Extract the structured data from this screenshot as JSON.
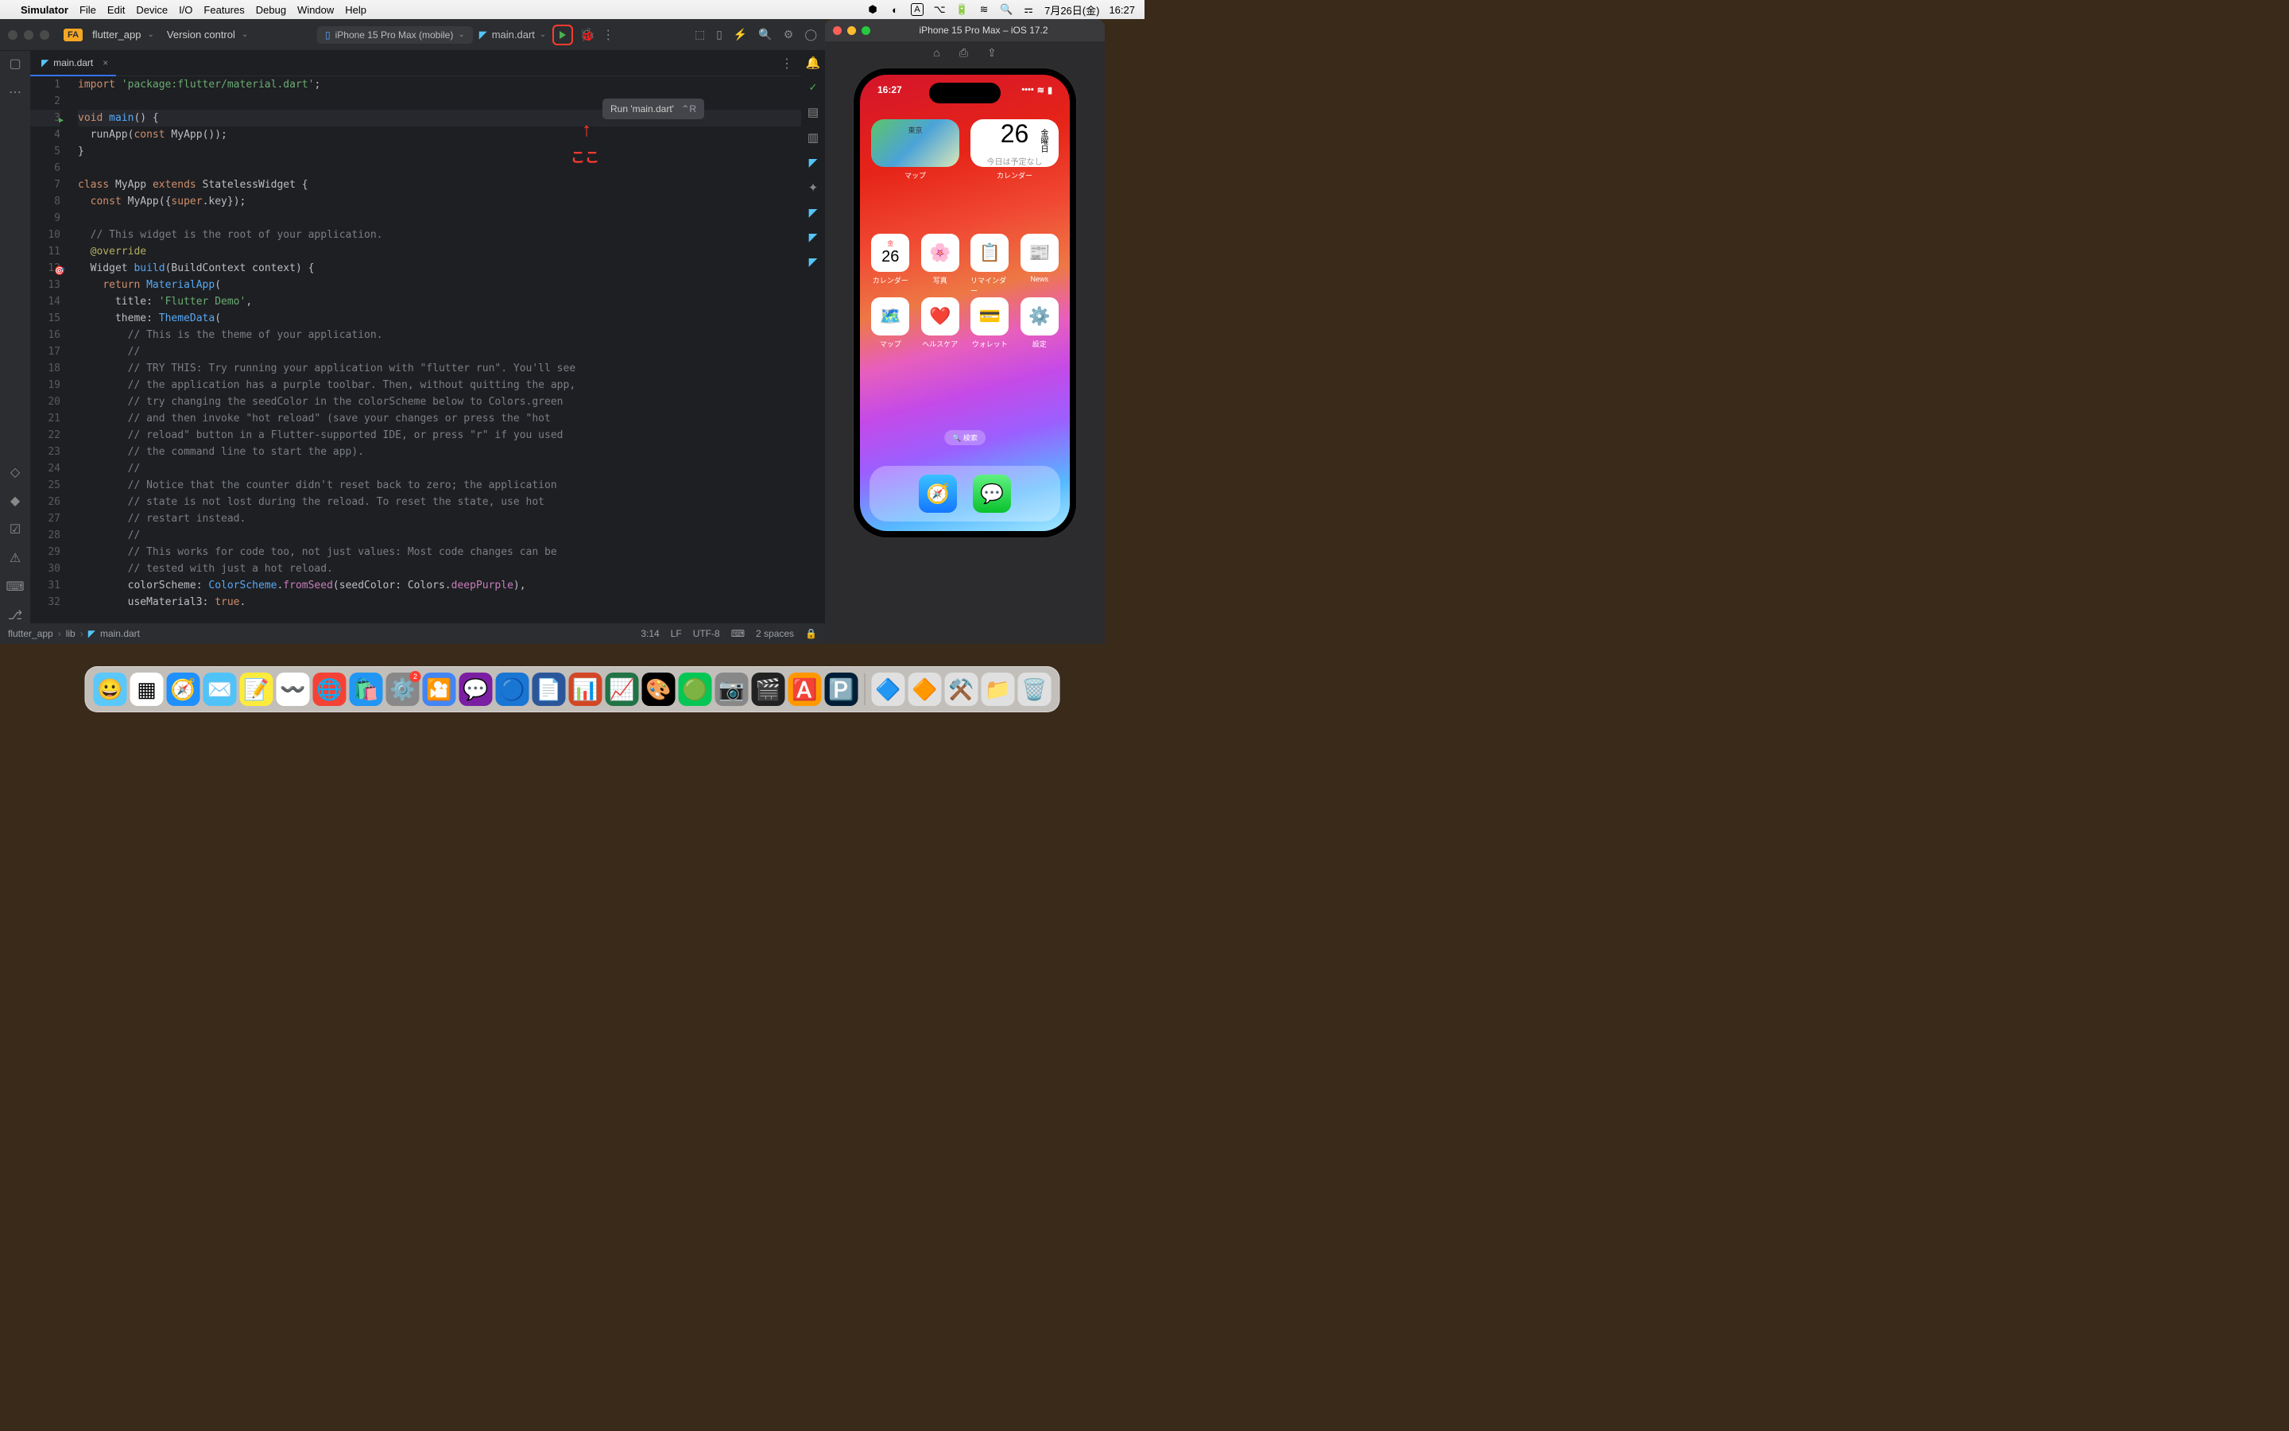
{
  "menubar": {
    "app": "Simulator",
    "items": [
      "File",
      "Edit",
      "Device",
      "I/O",
      "Features",
      "Debug",
      "Window",
      "Help"
    ],
    "date": "7月26日(金)",
    "time": "16:27",
    "input_label": "A"
  },
  "ide": {
    "project_badge": "FA",
    "project_name": "flutter_app",
    "version_control": "Version control",
    "device": "iPhone 15 Pro Max (mobile)",
    "config": "main.dart",
    "tab_file": "main.dart",
    "tooltip_text": "Run 'main.dart'",
    "tooltip_shortcut": "⌃R",
    "annotation_text": "ここ",
    "breadcrumb": [
      "flutter_app",
      "lib",
      "main.dart"
    ],
    "status": {
      "pos": "3:14",
      "lineend": "LF",
      "encoding": "UTF-8",
      "indent": "2 spaces"
    },
    "code": [
      {
        "n": 1,
        "tokens": [
          [
            "kw",
            "import"
          ],
          [
            "",
            " "
          ],
          [
            "str",
            "'package:flutter/material.dart'"
          ],
          [
            "",
            ";"
          ]
        ]
      },
      {
        "n": 2,
        "tokens": []
      },
      {
        "n": 3,
        "hl": true,
        "run": true,
        "tokens": [
          [
            "kw",
            "void"
          ],
          [
            "",
            " "
          ],
          [
            "fn",
            "main"
          ],
          [
            "",
            "() {"
          ]
        ]
      },
      {
        "n": 4,
        "tokens": [
          [
            "",
            "  runApp("
          ],
          [
            "kw",
            "const"
          ],
          [
            "",
            " "
          ],
          [
            "cls",
            "MyApp"
          ],
          [
            "",
            "());"
          ]
        ]
      },
      {
        "n": 5,
        "tokens": [
          [
            "",
            "}"
          ]
        ]
      },
      {
        "n": 6,
        "tokens": []
      },
      {
        "n": 7,
        "tokens": [
          [
            "kw",
            "class"
          ],
          [
            "",
            " "
          ],
          [
            "cls",
            "MyApp"
          ],
          [
            "",
            " "
          ],
          [
            "kw",
            "extends"
          ],
          [
            "",
            " "
          ],
          [
            "cls",
            "StatelessWidget"
          ],
          [
            "",
            " {"
          ]
        ]
      },
      {
        "n": 8,
        "tokens": [
          [
            "",
            "  "
          ],
          [
            "kw",
            "const"
          ],
          [
            "",
            " "
          ],
          [
            "cls",
            "MyApp"
          ],
          [
            "",
            "({"
          ],
          [
            "kw",
            "super"
          ],
          [
            "",
            ".key});"
          ]
        ]
      },
      {
        "n": 9,
        "tokens": []
      },
      {
        "n": 10,
        "tokens": [
          [
            "",
            "  "
          ],
          [
            "cmt",
            "// This widget is the root of your application."
          ]
        ]
      },
      {
        "n": 11,
        "tokens": [
          [
            "",
            "  "
          ],
          [
            "ann",
            "@override"
          ]
        ]
      },
      {
        "n": 12,
        "target": true,
        "tokens": [
          [
            "",
            "  "
          ],
          [
            "cls",
            "Widget"
          ],
          [
            "",
            " "
          ],
          [
            "fn",
            "build"
          ],
          [
            "",
            "(BuildContext context) {"
          ]
        ]
      },
      {
        "n": 13,
        "tokens": [
          [
            "",
            "    "
          ],
          [
            "kw",
            "return"
          ],
          [
            "",
            " "
          ],
          [
            "fn",
            "MaterialApp"
          ],
          [
            "",
            "("
          ]
        ]
      },
      {
        "n": 14,
        "tokens": [
          [
            "",
            "      title: "
          ],
          [
            "str",
            "'Flutter Demo'"
          ],
          [
            "",
            ","
          ]
        ]
      },
      {
        "n": 15,
        "tokens": [
          [
            "",
            "      theme: "
          ],
          [
            "fn",
            "ThemeData"
          ],
          [
            "",
            "("
          ]
        ]
      },
      {
        "n": 16,
        "tokens": [
          [
            "",
            "        "
          ],
          [
            "cmt",
            "// This is the theme of your application."
          ]
        ]
      },
      {
        "n": 17,
        "tokens": [
          [
            "",
            "        "
          ],
          [
            "cmt",
            "//"
          ]
        ]
      },
      {
        "n": 18,
        "tokens": [
          [
            "",
            "        "
          ],
          [
            "cmt",
            "// TRY THIS: Try running your application with \"flutter run\". You'll see"
          ]
        ]
      },
      {
        "n": 19,
        "tokens": [
          [
            "",
            "        "
          ],
          [
            "cmt",
            "// the application has a purple toolbar. Then, without quitting the app,"
          ]
        ]
      },
      {
        "n": 20,
        "tokens": [
          [
            "",
            "        "
          ],
          [
            "cmt",
            "// try changing the seedColor in the colorScheme below to Colors.green"
          ]
        ]
      },
      {
        "n": 21,
        "tokens": [
          [
            "",
            "        "
          ],
          [
            "cmt",
            "// and then invoke \"hot reload\" (save your changes or press the \"hot"
          ]
        ]
      },
      {
        "n": 22,
        "tokens": [
          [
            "",
            "        "
          ],
          [
            "cmt",
            "// reload\" button in a Flutter-supported IDE, or press \"r\" if you used"
          ]
        ]
      },
      {
        "n": 23,
        "tokens": [
          [
            "",
            "        "
          ],
          [
            "cmt",
            "// the command line to start the app)."
          ]
        ]
      },
      {
        "n": 24,
        "tokens": [
          [
            "",
            "        "
          ],
          [
            "cmt",
            "//"
          ]
        ]
      },
      {
        "n": 25,
        "tokens": [
          [
            "",
            "        "
          ],
          [
            "cmt",
            "// Notice that the counter didn't reset back to zero; the application"
          ]
        ]
      },
      {
        "n": 26,
        "tokens": [
          [
            "",
            "        "
          ],
          [
            "cmt",
            "// state is not lost during the reload. To reset the state, use hot"
          ]
        ]
      },
      {
        "n": 27,
        "tokens": [
          [
            "",
            "        "
          ],
          [
            "cmt",
            "// restart instead."
          ]
        ]
      },
      {
        "n": 28,
        "tokens": [
          [
            "",
            "        "
          ],
          [
            "cmt",
            "//"
          ]
        ]
      },
      {
        "n": 29,
        "tokens": [
          [
            "",
            "        "
          ],
          [
            "cmt",
            "// This works for code too, not just values: Most code changes can be"
          ]
        ]
      },
      {
        "n": 30,
        "tokens": [
          [
            "",
            "        "
          ],
          [
            "cmt",
            "// tested with just a hot reload."
          ]
        ]
      },
      {
        "n": 31,
        "tokens": [
          [
            "",
            "        colorScheme: "
          ],
          [
            "fn",
            "ColorScheme"
          ],
          [
            "",
            "."
          ],
          [
            "fn2",
            "fromSeed"
          ],
          [
            "",
            "(seedColor: Colors."
          ],
          [
            "prop",
            "deepPurple"
          ],
          [
            "",
            "),"
          ]
        ]
      },
      {
        "n": 32,
        "tokens": [
          [
            "",
            "        useMaterial3: "
          ],
          [
            "kw",
            "true"
          ],
          [
            "",
            "."
          ]
        ]
      }
    ]
  },
  "simulator": {
    "title": "iPhone 15 Pro Max – iOS 17.2",
    "phone_time": "16:27",
    "cal_widget_day": "26",
    "cal_widget_weekday": "金曜日",
    "cal_widget_text": "今日は予定なし",
    "widget_labels": [
      "マップ",
      "カレンダー"
    ],
    "app_row1": [
      {
        "icon": "📅",
        "label": "カレンダー",
        "text": "26",
        "weekday": "金"
      },
      {
        "icon": "🌸",
        "label": "写真"
      },
      {
        "icon": "📋",
        "label": "リマインダー"
      },
      {
        "icon": "📰",
        "label": "News"
      }
    ],
    "app_row2": [
      {
        "icon": "🗺️",
        "label": "マップ"
      },
      {
        "icon": "❤️",
        "label": "ヘルスケア"
      },
      {
        "icon": "💳",
        "label": "ウォレット"
      },
      {
        "icon": "⚙️",
        "label": "設定"
      }
    ],
    "search_label": "🔍 検索",
    "dock_apps": [
      "🧭",
      "💬"
    ]
  },
  "mac_dock": {
    "items": [
      "😀",
      "▦",
      "🧭",
      "✉️",
      "📝",
      "〰️",
      "🌐",
      "🛍️",
      "⚙️",
      "🎦",
      "💬",
      "🔵",
      "📄",
      "📊",
      "📈",
      "🎨",
      "🟢",
      "📷",
      "🎬",
      "🅰️",
      "🅿️"
    ],
    "right_items": [
      "🔷",
      "🔶",
      "⚒️",
      "📁",
      "🗑️"
    ],
    "settings_badge": "2"
  }
}
